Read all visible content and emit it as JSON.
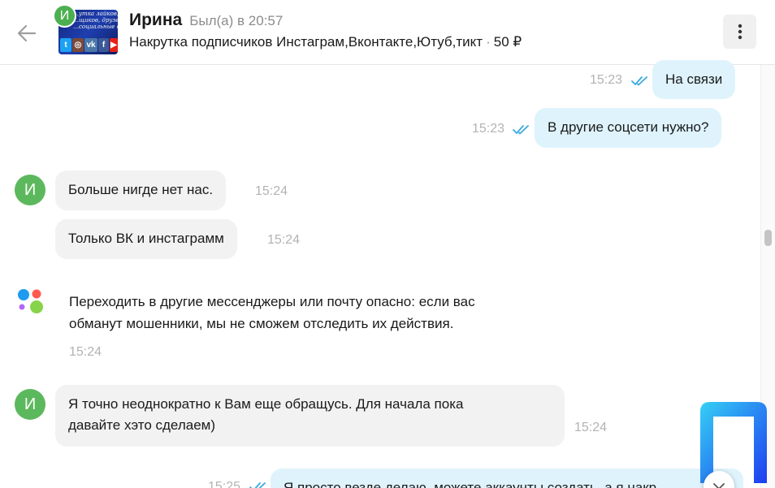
{
  "header": {
    "avatar_letter": "И",
    "contact_name": "Ирина",
    "last_seen": "Был(а) в 20:57",
    "ad_title": "Накрутка подписчиков Инстаграм,Вконтакте,Ютуб,тикт",
    "ad_separator": "·",
    "ad_price": "50 ₽",
    "thumbnail_text": [
      "…утка лайков,",
      "…щиков, друзей",
      "…социальные сет"
    ],
    "thumbnail_icons": [
      "twitter-icon",
      "instagram-icon",
      "vk-icon",
      "facebook-icon",
      "youtube-icon"
    ]
  },
  "messages": [
    {
      "direction": "out",
      "text": "На связи",
      "time": "15:23",
      "read": true
    },
    {
      "direction": "out",
      "text": "В другие соцсети нужно?",
      "time": "15:23",
      "read": true
    },
    {
      "direction": "in",
      "avatar_letter": "И",
      "text": "Больше нигде нет нас.",
      "time": "15:24"
    },
    {
      "direction": "in",
      "text": "Только ВК и инстаграмм",
      "time": "15:24"
    },
    {
      "direction": "in",
      "avatar_letter": "И",
      "lines": [
        "Я точно неоднократно к Вам еще обращусь. Для начала пока",
        "давайте хэто сделаем)"
      ],
      "time": "15:24"
    },
    {
      "direction": "out",
      "text": "Я просто везде делаю, можете аккаунты создать, а я накр",
      "time": "15:25",
      "read": true
    }
  ],
  "system_notice": {
    "lines": [
      "Переходить в другие мессенджеры или почту опасно: если вас",
      "обманут мошенники, мы не сможем отследить их действия."
    ],
    "time": "15:24"
  },
  "colors": {
    "outgoing_bubble": "#dff3fc",
    "incoming_bubble": "#f2f2f2",
    "avatar": "#5cb85c",
    "check_marks": "#3aa9e3"
  }
}
